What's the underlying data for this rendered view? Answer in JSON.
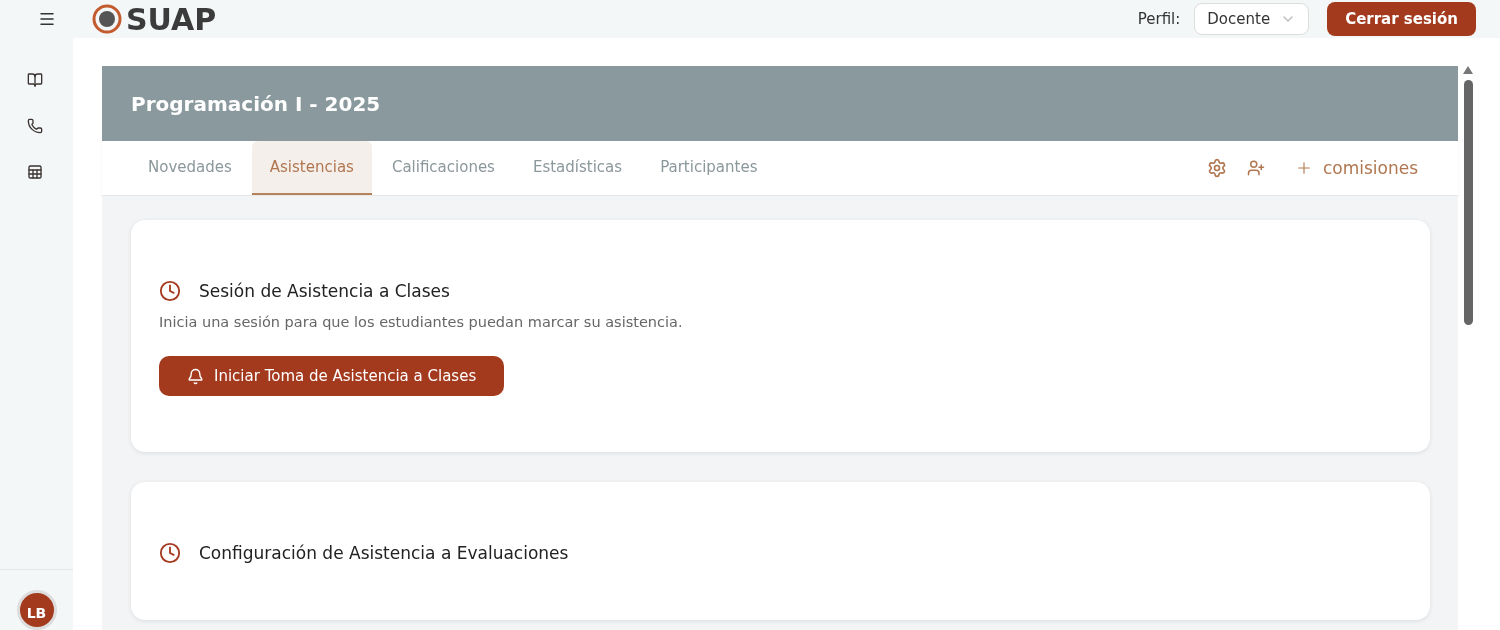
{
  "header": {
    "logo": "SUAP",
    "profile_label": "Perfil:",
    "profile_value": "Docente",
    "logout": "Cerrar sesión"
  },
  "sidebar": {
    "items": [
      {
        "kind": "book"
      },
      {
        "kind": "phone"
      },
      {
        "kind": "sheet"
      }
    ],
    "avatar": "LB"
  },
  "course": {
    "title": "Programación I - 2025"
  },
  "tabs": [
    {
      "label": "Novedades",
      "selected": false
    },
    {
      "label": "Asistencias",
      "selected": true
    },
    {
      "label": "Calificaciones",
      "selected": false
    },
    {
      "label": "Estadísticas",
      "selected": false
    },
    {
      "label": "Participantes",
      "selected": false
    }
  ],
  "actions": {
    "add_label": "comisiones"
  },
  "cards": [
    {
      "title": "Sesión de Asistencia a Clases",
      "description": "Inicia una sesión para que los estudiantes puedan marcar su asistencia.",
      "button": "Iniciar Toma de Asistencia a Clases"
    },
    {
      "title": "Configuración de Asistencia a Evaluaciones"
    }
  ]
}
